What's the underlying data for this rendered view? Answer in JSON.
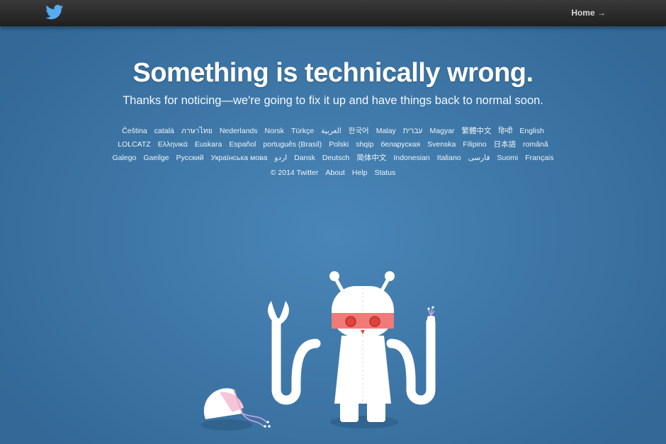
{
  "header": {
    "logo_icon": "twitter-bird-icon",
    "home_label": "Home →"
  },
  "main": {
    "headline": "Something is technically wrong.",
    "subhead": "Thanks for noticing—we're going to fix it up and have things back to normal soon."
  },
  "languages": {
    "row1": [
      "Čeština",
      "català",
      "ภาษาไทย",
      "Nederlands",
      "Norsk",
      "Türkçe",
      "العربية",
      "한국어",
      "Malay",
      "עברית",
      "Magyar",
      "繁體中文",
      "हिन्दी",
      "English"
    ],
    "row2": [
      "LOLCATZ",
      "Ελληνικά",
      "Euskara",
      "Español",
      "português (Brasil)",
      "Polski",
      "shqip",
      "беларуская",
      "Svenska",
      "Filipino",
      "日本語",
      "română"
    ],
    "row3": [
      "Galego",
      "Gaeilge",
      "Русский",
      "Українська мова",
      "اردو",
      "Dansk",
      "Deutsch",
      "简体中文",
      "Indonesian",
      "Italiano",
      "فارسی",
      "Suomi",
      "Français"
    ]
  },
  "footer": {
    "copyright": "© 2014 Twitter",
    "about": "About",
    "help": "Help",
    "status": "Status"
  },
  "illustration": {
    "name": "broken-robot-illustration",
    "colors": {
      "background": "#3f79a9",
      "topbar": "#2a2a2a",
      "bird": "#55acee",
      "robot_body": "#ffffff",
      "visor": "#f07a78",
      "eyes": "#e0413d",
      "shadow": "#2f5f88",
      "wires": "#c8a6e0"
    }
  }
}
